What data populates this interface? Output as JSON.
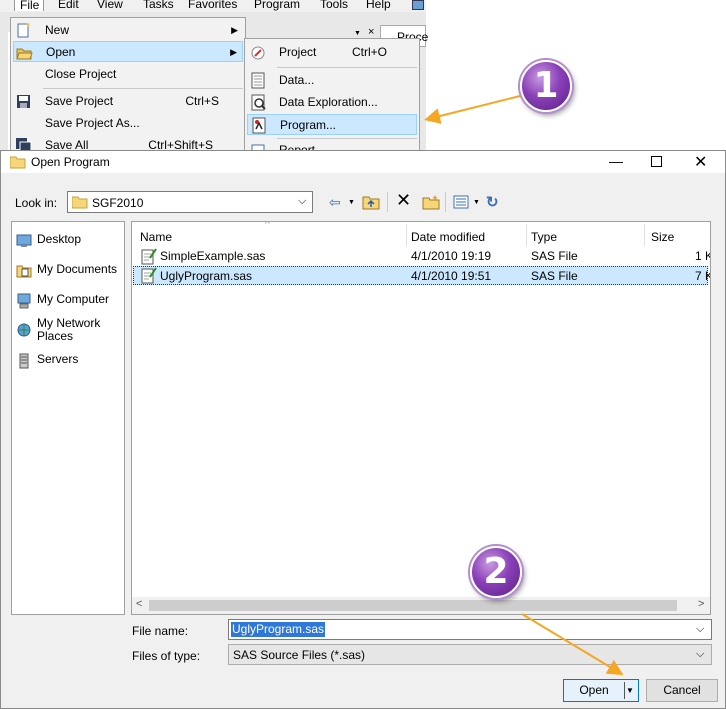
{
  "menubar": {
    "items": [
      "File",
      "Edit",
      "View",
      "Tasks",
      "Favorites",
      "Program",
      "Tools",
      "Help"
    ]
  },
  "bg_tab": "Proce",
  "bg_close": "×",
  "file_menu": {
    "items": [
      {
        "label": "New",
        "icon": "new-icon",
        "submenu": true
      },
      {
        "label": "Open",
        "icon": "open-folder-icon",
        "submenu": true,
        "highlighted": true
      },
      {
        "label": "Close Project"
      },
      {
        "label": "Save Project",
        "shortcut": "Ctrl+S",
        "icon": "save-icon"
      },
      {
        "label": "Save Project As..."
      },
      {
        "label": "Save All",
        "shortcut": "Ctrl+Shift+S",
        "icon": "save-all-icon"
      }
    ]
  },
  "open_submenu": {
    "items": [
      {
        "label": "Project",
        "shortcut": "Ctrl+O",
        "icon": "project-icon"
      },
      {
        "label": "Data...",
        "icon": "data-icon"
      },
      {
        "label": "Data Exploration...",
        "icon": "data-exploration-icon"
      },
      {
        "label": "Program...",
        "icon": "program-icon",
        "highlighted": true
      },
      {
        "label": "Report",
        "icon": "report-icon"
      }
    ]
  },
  "dialog": {
    "title": "Open Program",
    "look_in_label": "Look in:",
    "look_in_value": "SGF2010",
    "places": [
      "Desktop",
      "My Documents",
      "My Computer",
      "My Network Places",
      "Servers"
    ],
    "columns": [
      "Name",
      "Date modified",
      "Type",
      "Size"
    ],
    "files": [
      {
        "name": "SimpleExample.sas",
        "date": "4/1/2010 19:19",
        "type": "SAS File",
        "size": "1 K"
      },
      {
        "name": "UglyProgram.sas",
        "date": "4/1/2010 19:51",
        "type": "SAS File",
        "size": "7 K",
        "selected": true
      }
    ],
    "file_name_label": "File name:",
    "file_name_value": "UglyProgram.sas",
    "files_of_type_label": "Files of type:",
    "files_of_type_value": "SAS Source Files (*.sas)",
    "open_button": "Open",
    "cancel_button": "Cancel"
  },
  "callouts": {
    "step1": "1",
    "step2": "2"
  },
  "colors": {
    "highlight": "#cce8ff",
    "arrow": "#f5a623",
    "badge": "#7b35a8"
  }
}
